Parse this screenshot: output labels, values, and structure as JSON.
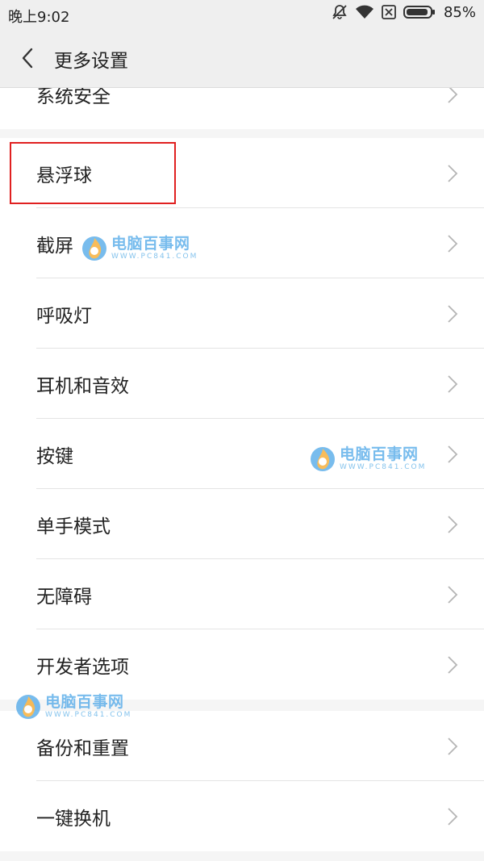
{
  "status_bar": {
    "time": "晚上9:02",
    "battery_percent": "85%",
    "icons": [
      "mute-icon",
      "wifi-icon",
      "sim-off-icon",
      "battery-icon"
    ]
  },
  "header": {
    "title": "更多设置",
    "back_icon": "back-arrow-icon"
  },
  "settings": {
    "partial_item": "系统安全",
    "group1": [
      "悬浮球",
      "截屏",
      "呼吸灯",
      "耳机和音效",
      "按键",
      "单手模式",
      "无障碍",
      "开发者选项"
    ],
    "group2": [
      "备份和重置",
      "一键换机"
    ]
  },
  "watermark": {
    "name": "电脑百事网",
    "url": "WWW.PC841.COM"
  },
  "colors": {
    "highlight": "#e02020",
    "background": "#f5f5f5",
    "header_bg": "#efefef",
    "watermark": "#4ba6e8"
  }
}
